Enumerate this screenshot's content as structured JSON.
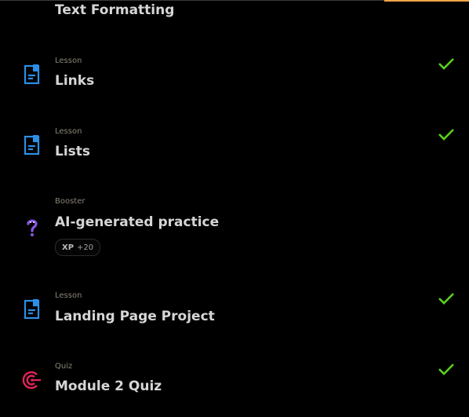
{
  "colors": {
    "accent": "#f0a64b",
    "check": "#59d11c",
    "lesson_icon": "#2c8fe6",
    "booster_icon": "#8a56e6",
    "quiz_icon": "#e0255a"
  },
  "partial_item": {
    "title": "Text Formatting"
  },
  "items": [
    {
      "kind": "Lesson",
      "title": "Links",
      "icon": "lesson-icon",
      "completed": true
    },
    {
      "kind": "Lesson",
      "title": "Lists",
      "icon": "lesson-icon",
      "completed": true
    },
    {
      "kind": "Booster",
      "title": "AI-generated practice",
      "icon": "question-mark-icon",
      "completed": false,
      "xp": {
        "label": "XP",
        "value": "+20"
      }
    },
    {
      "kind": "Lesson",
      "title": "Landing Page Project",
      "icon": "lesson-icon",
      "completed": true
    },
    {
      "kind": "Quiz",
      "title": "Module 2 Quiz",
      "icon": "target-icon",
      "completed": true
    }
  ]
}
